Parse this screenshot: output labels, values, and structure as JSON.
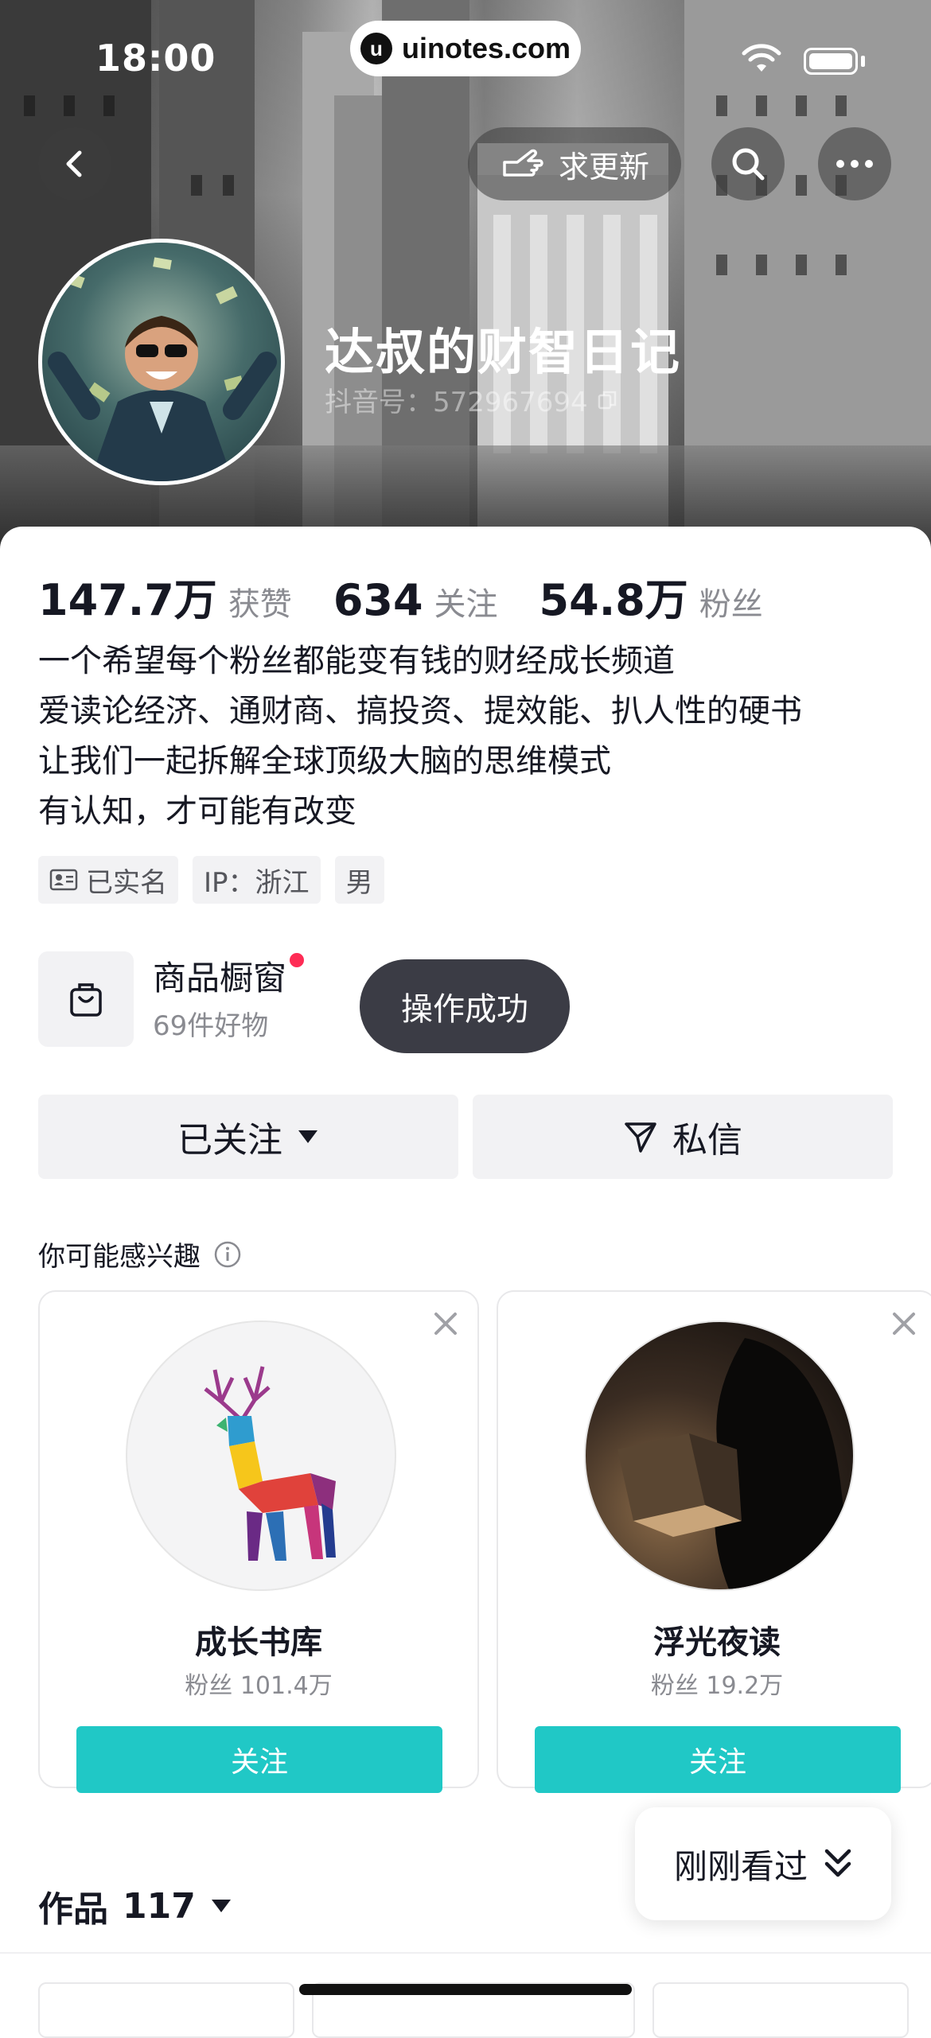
{
  "status_bar": {
    "time": "18:00",
    "url": "uinotes.com",
    "url_logo": "u"
  },
  "header": {
    "back_icon": "chevron-left-icon",
    "update_label": "求更新",
    "search_icon": "search-icon",
    "more_icon": "more-dots-icon"
  },
  "profile": {
    "nickname": "达叔的财智日记",
    "douyin_id": "抖音号：572967694",
    "copy_icon": "copy-icon"
  },
  "stats": [
    {
      "num": "147.7万",
      "label": "获赞"
    },
    {
      "num": "634",
      "label": "关注"
    },
    {
      "num": "54.8万",
      "label": "粉丝"
    }
  ],
  "bio": [
    "一个希望每个粉丝都能变有钱的财经成长频道",
    "爱读论经济、通财商、搞投资、提效能、扒人性的硬书",
    "让我们一起拆解全球顶级大脑的思维模式",
    "有认知，才可能有改变"
  ],
  "tags": {
    "verified": "已实名",
    "ip": "IP：浙江",
    "gender": "男"
  },
  "shop": {
    "title": "商品橱窗",
    "subtitle": "69件好物"
  },
  "toast": "操作成功",
  "buttons": {
    "following": "已关注",
    "message": "私信"
  },
  "interest": {
    "title": "你可能感兴趣"
  },
  "recommendations": [
    {
      "name": "成长书库",
      "fans": "粉丝 101.4万",
      "follow": "关注"
    },
    {
      "name": "浮光夜读",
      "fans": "粉丝 19.2万",
      "follow": "关注"
    }
  ],
  "recent": {
    "label": "刚刚看过"
  },
  "works": {
    "label": "作品",
    "count": "117"
  },
  "colors": {
    "accent": "#20c8c6",
    "red_dot": "#fe2c55",
    "toast_bg": "#3b3c45"
  }
}
